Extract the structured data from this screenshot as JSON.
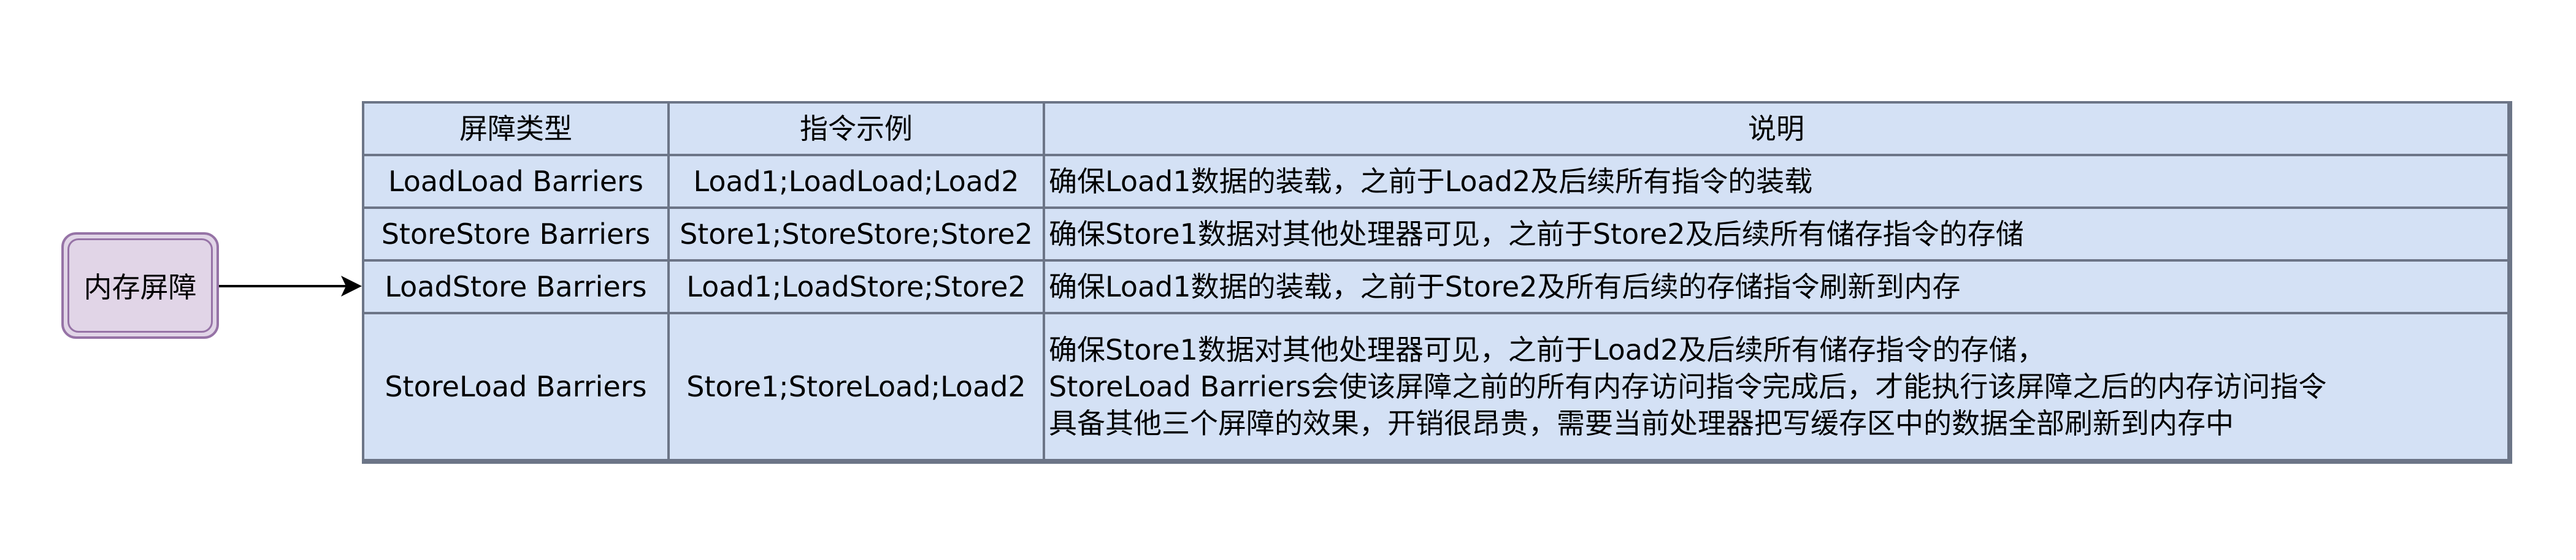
{
  "node": {
    "label": "内存屏障"
  },
  "table": {
    "headers": [
      "屏障类型",
      "指令示例",
      "说明"
    ],
    "rows": [
      {
        "type": "LoadLoad Barriers",
        "example": "Load1;LoadLoad;Load2",
        "description": [
          "确保Load1数据的装载，之前于Load2及后续所有指令的装载"
        ]
      },
      {
        "type": "StoreStore Barriers",
        "example": "Store1;StoreStore;Store2",
        "description": [
          "确保Store1数据对其他处理器可见，之前于Store2及后续所有储存指令的存储"
        ]
      },
      {
        "type": "LoadStore Barriers",
        "example": "Load1;LoadStore;Store2",
        "description": [
          "确保Load1数据的装载，之前于Store2及所有后续的存储指令刷新到内存"
        ]
      },
      {
        "type": "StoreLoad Barriers",
        "example": "Store1;StoreLoad;Load2",
        "description": [
          "确保Store1数据对其他处理器可见，之前于Load2及后续所有储存指令的存储，",
          "StoreLoad Barriers会使该屏障之前的所有内存访问指令完成后，才能执行该屏障之后的内存访问指令",
          "具备其他三个屏障的效果，开销很昂贵，需要当前处理器把写缓存区中的数据全部刷新到内存中"
        ]
      }
    ]
  },
  "colors": {
    "node_fill": "#e1d5e7",
    "node_stroke": "#9673a6",
    "table_fill": "#d4e1f5",
    "table_stroke": "#6c7587"
  }
}
